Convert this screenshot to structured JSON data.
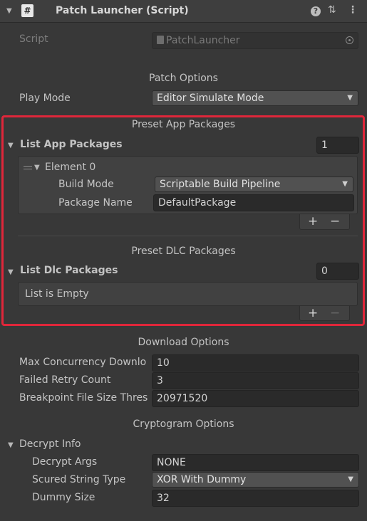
{
  "header": {
    "title": "Patch Launcher (Script)"
  },
  "script_field": {
    "label": "Script",
    "value": "PatchLauncher"
  },
  "patch_options": {
    "header": "Patch Options",
    "play_mode_label": "Play Mode",
    "play_mode_value": "Editor Simulate Mode"
  },
  "app_packages": {
    "header": "Preset App Packages",
    "list_label": "List App Packages",
    "count": "1",
    "element_label": "Element 0",
    "build_mode_label": "Build Mode",
    "build_mode_value": "Scriptable Build Pipeline",
    "package_name_label": "Package Name",
    "package_name_value": "DefaultPackage",
    "add_label": "+",
    "remove_label": "−"
  },
  "dlc_packages": {
    "header": "Preset DLC Packages",
    "list_label": "List Dlc Packages",
    "count": "0",
    "empty_text": "List is Empty",
    "add_label": "+",
    "remove_label": "−"
  },
  "download_options": {
    "header": "Download Options",
    "max_concurrency_label": "Max Concurrency Downlo",
    "max_concurrency_value": "10",
    "failed_retry_label": "Failed Retry Count",
    "failed_retry_value": "3",
    "breakpoint_label": "Breakpoint File Size Thres",
    "breakpoint_value": "20971520"
  },
  "cryptogram_options": {
    "header": "Cryptogram Options",
    "decrypt_info_label": "Decrypt Info",
    "decrypt_args_label": "Decrypt Args",
    "decrypt_args_value": "NONE",
    "string_type_label": "Scured String Type",
    "string_type_value": "XOR With Dummy",
    "dummy_size_label": "Dummy Size",
    "dummy_size_value": "32"
  },
  "colors": {
    "panel_bg": "#383838",
    "field_bg": "#2a2a2a",
    "dropdown_bg": "#515151",
    "highlight": "#e0263a"
  },
  "icons": [
    "script-icon",
    "foldout-icon",
    "help-icon",
    "presets-icon",
    "menu-icon",
    "object-picker-icon",
    "dropdown-arrow-icon",
    "drag-handle-icon"
  ]
}
